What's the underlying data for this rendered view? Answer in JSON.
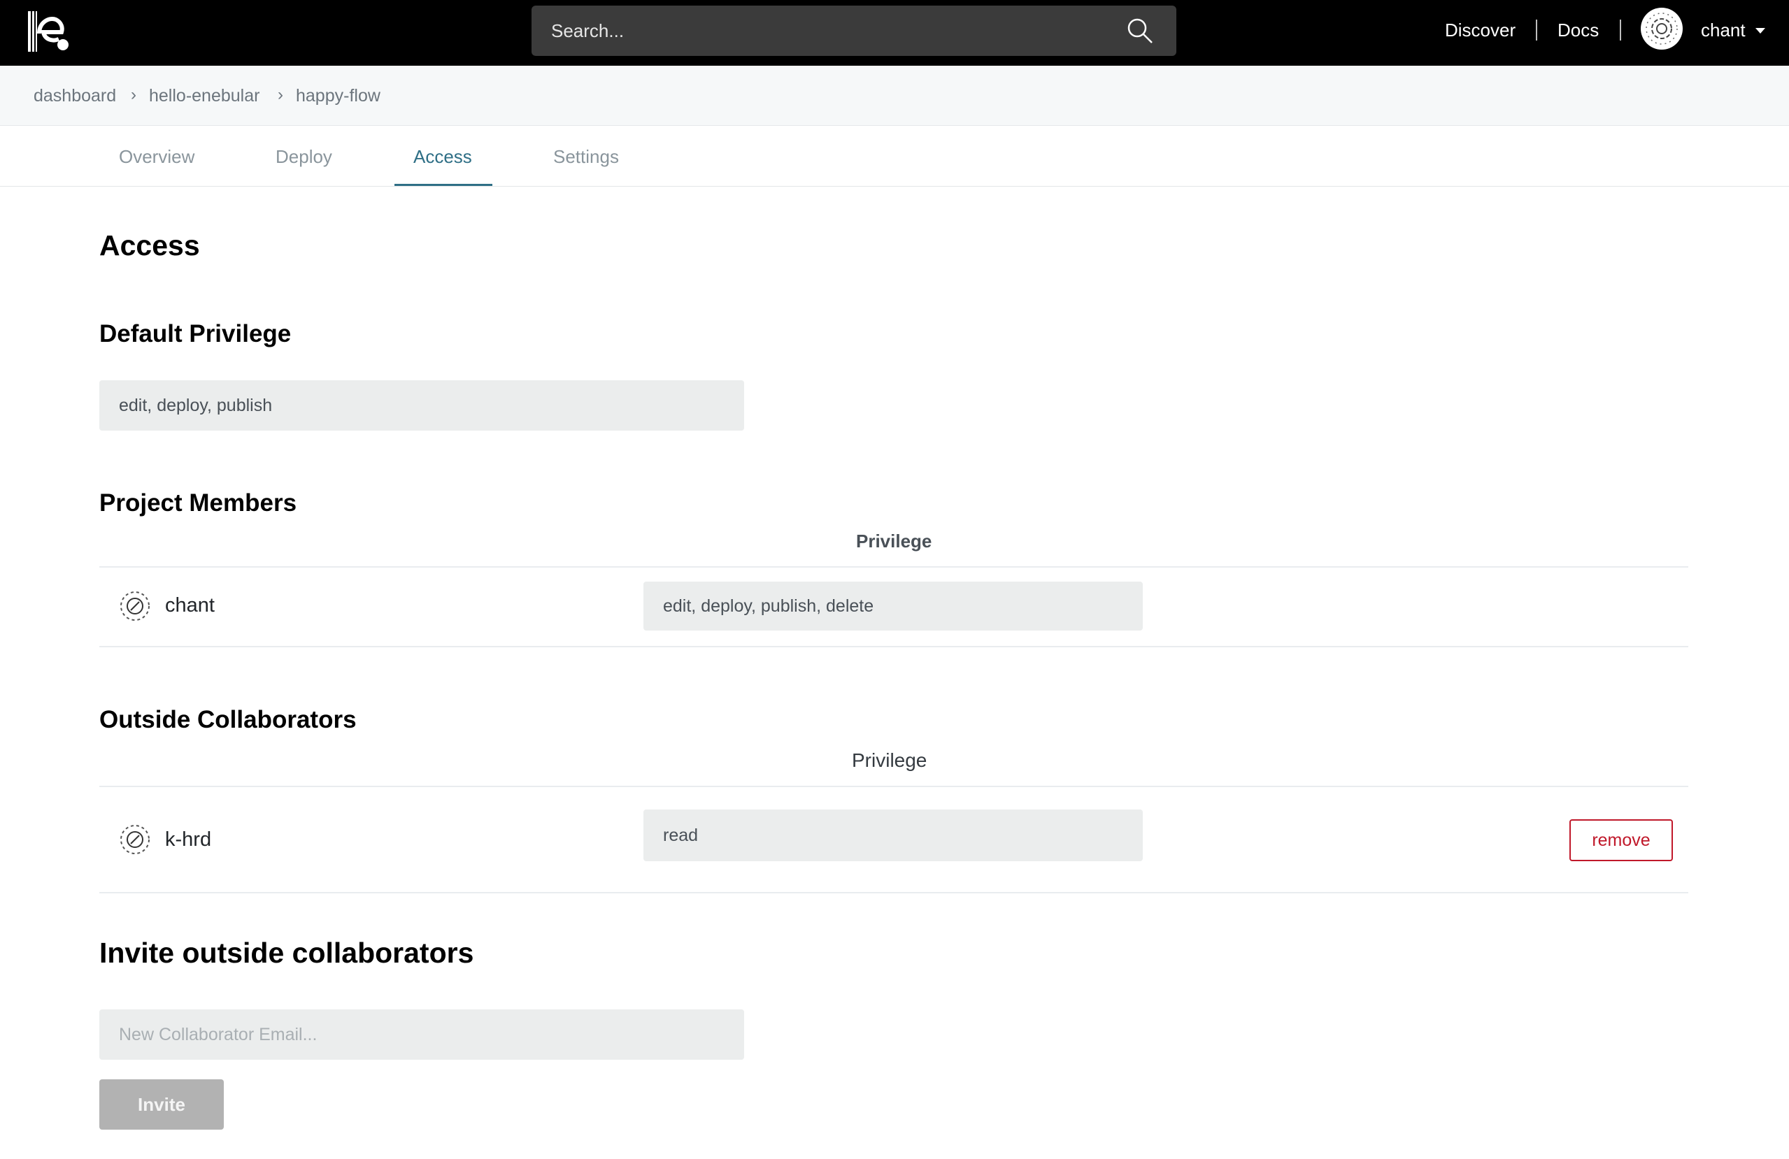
{
  "navbar": {
    "search_placeholder": "Search...",
    "links": [
      "Discover",
      "Docs"
    ],
    "user_name": "chant"
  },
  "breadcrumb": [
    "dashboard",
    "hello-enebular",
    "happy-flow"
  ],
  "breadcrumb_separator": "›",
  "tabs": [
    {
      "label": "Overview",
      "active": false
    },
    {
      "label": "Deploy",
      "active": false
    },
    {
      "label": "Access",
      "active": true
    },
    {
      "label": "Settings",
      "active": false
    }
  ],
  "page_title": "Access",
  "default_privilege": {
    "heading": "Default Privilege",
    "value": "edit, deploy, publish"
  },
  "project_members": {
    "heading": "Project Members",
    "column_header": "Privilege",
    "rows": [
      {
        "name": "chant",
        "privilege": "edit, deploy, publish, delete"
      }
    ]
  },
  "outside_collaborators": {
    "heading": "Outside Collaborators",
    "column_header": "Privilege",
    "rows": [
      {
        "name": "k-hrd",
        "privilege": "read",
        "action": "remove"
      }
    ]
  },
  "invite": {
    "heading": "Invite outside collaborators",
    "email_placeholder": "New Collaborator Email...",
    "button_label": "Invite"
  },
  "colors": {
    "navbar": "#000000",
    "active_tab": "#2f6f86",
    "danger": "#c0182a",
    "field_bg": "#ebeded"
  }
}
